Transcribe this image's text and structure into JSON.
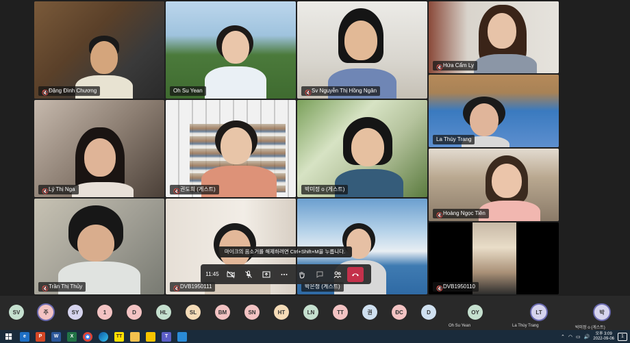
{
  "participants": [
    {
      "name": "Đặng Đình Chương",
      "muted": true
    },
    {
      "name": "Oh Su Yean",
      "muted": false
    },
    {
      "name": "Sv Nguyễn Thị Hồng Ngân",
      "muted": true
    },
    {
      "name": "Hứa Cẩm Ly",
      "muted": true
    },
    {
      "name": "La Thùy Trang",
      "muted": false
    },
    {
      "name": "Lý Thị Nga",
      "muted": true
    },
    {
      "name": "권도희 (게스트)",
      "muted": true
    },
    {
      "name": "박미정 o (게스트)",
      "muted": false
    },
    {
      "name": "Hoàng Ngọc Tiên",
      "muted": true
    },
    {
      "name": "Trần Thị Thủy",
      "muted": true
    },
    {
      "name": "DVB1950111",
      "muted": true
    },
    {
      "name": "박은정 (게스트)",
      "muted": false
    },
    {
      "name": "DVB1950110",
      "muted": true
    }
  ],
  "tooltip": "마이크의 음소거를 해제하려면 Ctrl+Shift+M을 누릅니다.",
  "controls": {
    "time": "11:45"
  },
  "strip": {
    "avatars": [
      "SV",
      "주",
      "SY",
      "1",
      "D",
      "HL",
      "SL",
      "BM",
      "SN",
      "HT",
      "LN",
      "TT",
      "권",
      "ĐC",
      "D"
    ],
    "named": [
      {
        "initials": "OY",
        "name": "Oh Su Yean"
      },
      {
        "initials": "LT",
        "name": "La Thùy Trang"
      },
      {
        "initials": "박",
        "name": "박미정 o (게스트)"
      }
    ]
  },
  "taskbar": {
    "clock_time": "오후 3:09",
    "clock_date": "2022-09-06",
    "notification_count": "1"
  },
  "colors": {
    "leave_red": "#c4314b",
    "strip_bg": "#292929",
    "taskbar_bg": "#1a2b3b"
  }
}
